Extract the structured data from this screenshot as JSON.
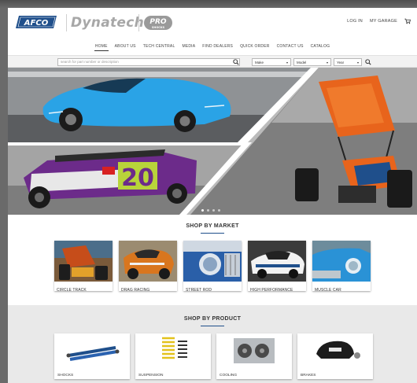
{
  "header": {
    "brand_afco": "AFCO",
    "brand_dynatech": "Dynatech",
    "brand_pro": "PRO",
    "brand_pro_sub": "SHOCKS",
    "login": "LOG IN",
    "garage": "MY GARAGE"
  },
  "nav": {
    "items": [
      "HOME",
      "ABOUT US",
      "TECH CENTRAL",
      "MEDIA",
      "FIND DEALERS",
      "QUICK ORDER",
      "CONTACT US",
      "CATALOG"
    ],
    "active_index": 0
  },
  "search": {
    "placeholder": "search for part number or description",
    "make": "Make",
    "model": "Model",
    "year": "Year"
  },
  "hero": {
    "car1_number": "20",
    "slides": 4,
    "active_slide": 1
  },
  "market": {
    "title": "SHOP BY MARKET",
    "items": [
      "CIRCLE TRACK",
      "DRAG RACING",
      "STREET ROD",
      "HIGH PERFORMANCE",
      "MUSCLE CAR"
    ]
  },
  "product": {
    "title": "SHOP BY PRODUCT",
    "items": [
      "SHOCKS",
      "SUSPENSION",
      "COOLING",
      "BRAKES"
    ]
  },
  "colors": {
    "brand_blue": "#1f4f8b",
    "hero_car_blue": "#2aa3e6",
    "sprint_orange": "#e8641c"
  }
}
